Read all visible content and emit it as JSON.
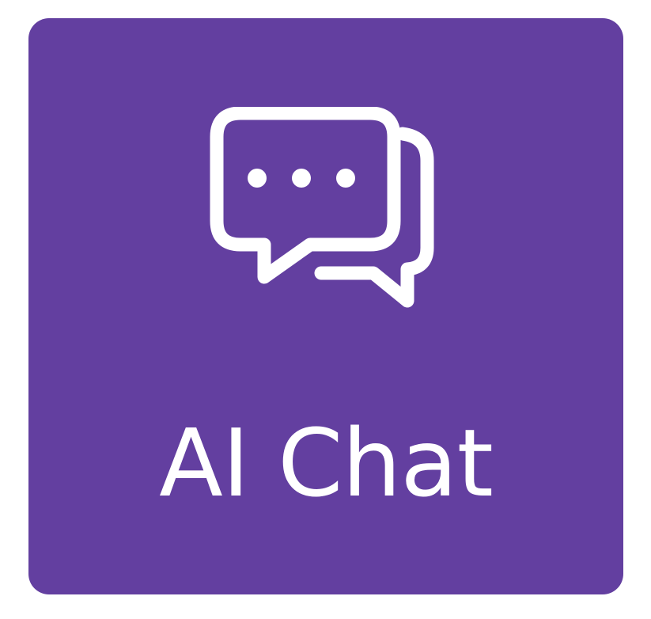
{
  "app_tile": {
    "label": "AI Chat",
    "icon": "chat-bubbles-icon",
    "background_color": "#633FA0",
    "foreground_color": "#FFFFFF"
  }
}
